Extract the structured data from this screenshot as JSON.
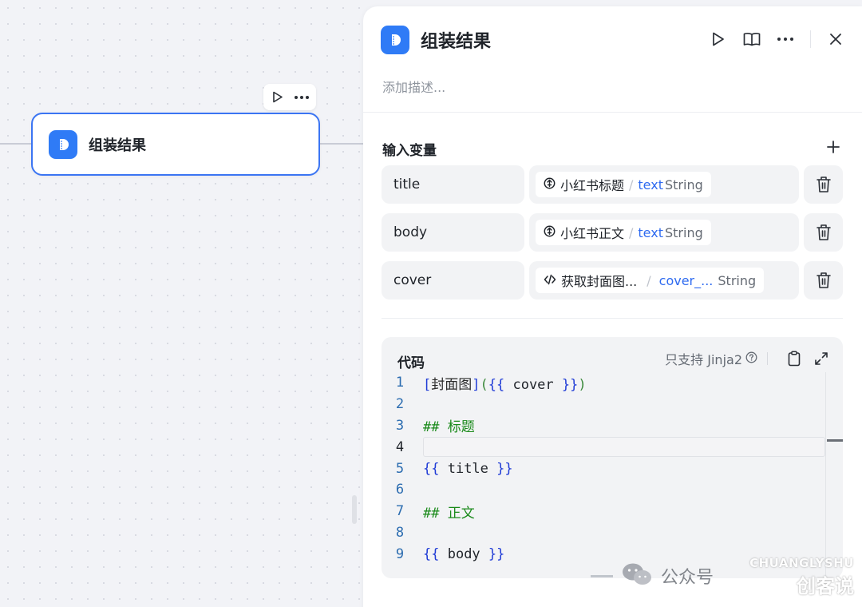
{
  "canvas": {
    "node": {
      "title": "组装结果",
      "icon": "code-block-icon"
    },
    "toolbar": {
      "run_icon": "play-icon",
      "more_icon": "more-horizontal-icon"
    }
  },
  "panel": {
    "title": "组装结果",
    "description_placeholder": "添加描述...",
    "header_actions": [
      "play-icon",
      "book-icon",
      "more-horizontal-icon",
      "close-icon"
    ],
    "inputs_section": {
      "title": "输入变量",
      "add_icon": "plus-icon",
      "variables": [
        {
          "name": "title",
          "ref_icon": "llm-icon",
          "ref_node": "小红书标题",
          "ref_field": "text",
          "ref_type": "String"
        },
        {
          "name": "body",
          "ref_icon": "llm-icon",
          "ref_node": "小红书正文",
          "ref_field": "text",
          "ref_type": "String"
        },
        {
          "name": "cover",
          "ref_icon": "code-icon",
          "ref_node": "获取封面图...",
          "ref_field": "cover_...",
          "ref_type": "String"
        }
      ]
    },
    "code_section": {
      "title": "代码",
      "support_label": "只支持 Jinja2",
      "lines": [
        {
          "no": "1",
          "text": "[封面图]({{ cover }})"
        },
        {
          "no": "2",
          "text": ""
        },
        {
          "no": "3",
          "text": "## 标题"
        },
        {
          "no": "4",
          "text": ""
        },
        {
          "no": "5",
          "text": "{{ title }}"
        },
        {
          "no": "6",
          "text": ""
        },
        {
          "no": "7",
          "text": "## 正文"
        },
        {
          "no": "8",
          "text": ""
        },
        {
          "no": "9",
          "text": "{{ body }}"
        }
      ]
    }
  },
  "watermark": {
    "prefix": "公众号",
    "brand_top": "CHUANGLYSHU",
    "brand_bottom": "创客说"
  }
}
